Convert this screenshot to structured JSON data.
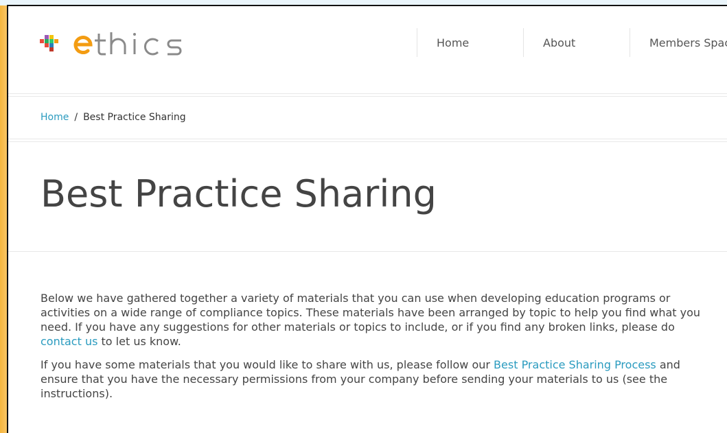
{
  "brand": {
    "logo_text": "ethics",
    "accent": "#f39c12",
    "text_color": "#777777"
  },
  "nav": {
    "items": [
      {
        "label": "Home"
      },
      {
        "label": "About"
      },
      {
        "label": "Members Spac"
      }
    ]
  },
  "breadcrumb": {
    "home": "Home",
    "separator": "/",
    "current": "Best Practice Sharing"
  },
  "page": {
    "title": "Best Practice Sharing"
  },
  "content": {
    "p1_a": "Below we have gathered together a variety of materials that you can use when developing education programs or activities on a wide range of compliance topics.  These materials have been arranged by topic to help you find what you need.  If you have any suggestions for other materials or topics to include, or if you find any broken links, please do ",
    "p1_link": "contact us",
    "p1_b": " to let us know.",
    "p2_a": "If you have some materials that you would like to share with us, please follow our ",
    "p2_link": "Best Practice Sharing Process",
    "p2_b": " and ensure that you have the necessary permissions from your company before sending your materials to us (see the instructions)."
  }
}
